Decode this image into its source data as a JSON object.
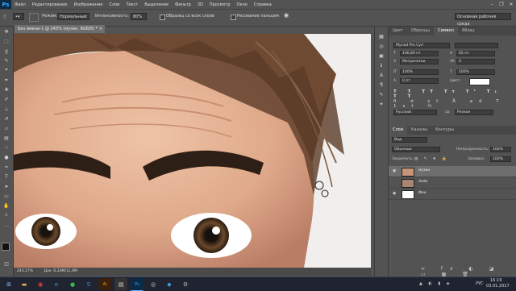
{
  "menu": {
    "logo": "Ps",
    "items": [
      "Файл",
      "Редактирование",
      "Изображение",
      "Слои",
      "Текст",
      "Выделение",
      "Фильтр",
      "3D",
      "Просмотр",
      "Окно",
      "Справка"
    ]
  },
  "options": {
    "mode_label": "Режим:",
    "mode_value": "Нормальный",
    "intensity_label": "Интенсивность:",
    "intensity_value": "80%",
    "all_layers_label": "Образец со всех слоев",
    "finger_label": "Рисование пальцем",
    "workspace_value": "Основная рабочая среда"
  },
  "document": {
    "tab_title": "Без имени-1 @ 243% (музин, RGB/8) *",
    "zoom": "243,17%",
    "doc_info": "Док: 6,23М/11,4М"
  },
  "character_panel": {
    "tabs": [
      "Цвет",
      "Образцы",
      "Символ",
      "Абзац"
    ],
    "active_tab": "Символ",
    "font_family": "Myriad Pro Cyrl",
    "font_style": "",
    "font_size": "106,69 пт",
    "leading": "65 пт",
    "kerning": "Метрически",
    "tracking": "0",
    "vscale": "100%",
    "hscale": "100%",
    "baseline": "0 пт",
    "color_label": "Цвет:",
    "language": "Русский",
    "aa": "Резкое"
  },
  "layers_panel": {
    "tabs": [
      "Слои",
      "Каналы",
      "Контуры"
    ],
    "active_tab": "Слои",
    "filter": "Вид",
    "blend_mode": "Обычные",
    "opacity_label": "Непрозрачность:",
    "opacity": "100%",
    "lock_label": "Закрепить:",
    "fill_label": "Заливка:",
    "fill": "100%",
    "layers": [
      {
        "name": "музин",
        "selected": true,
        "thumb": "face"
      },
      {
        "name": "dude",
        "selected": false,
        "thumb": "face2"
      },
      {
        "name": "Фон",
        "selected": false,
        "thumb": "white"
      }
    ]
  },
  "taskbar": {
    "lang": "РУС",
    "time": "16:19",
    "date": "03.01.2017"
  },
  "icons": {
    "tools": [
      "move-icon",
      "marquee-icon",
      "lasso-icon",
      "quick-select-icon",
      "crop-icon",
      "eyedropper-icon",
      "healing-icon",
      "brush-icon",
      "stamp-icon",
      "history-brush-icon",
      "eraser-icon",
      "gradient-icon",
      "smudge-icon",
      "dodge-icon",
      "pen-icon",
      "type-icon",
      "path-select-icon",
      "shape-icon",
      "hand-icon",
      "zoom-icon"
    ]
  }
}
